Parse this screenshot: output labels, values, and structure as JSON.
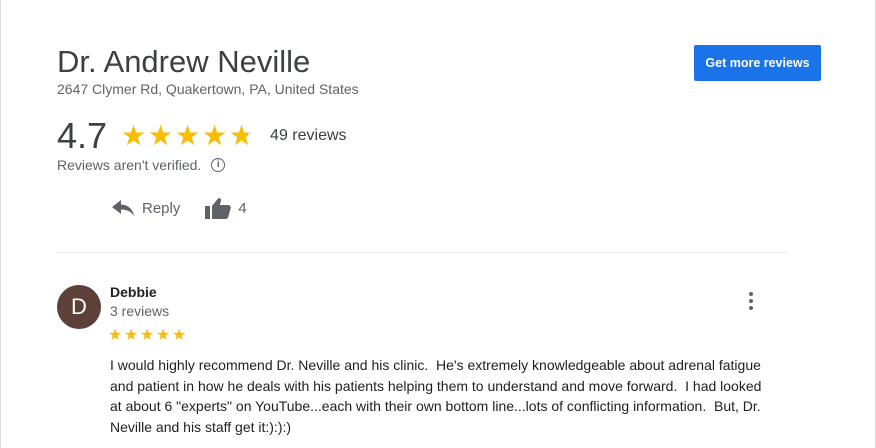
{
  "business": {
    "name": "Dr. Andrew Neville",
    "address": "2647 Clymer Rd, Quakertown, PA, United States"
  },
  "header": {
    "more_reviews_label": "Get more reviews"
  },
  "rating": {
    "value_text": "4.7",
    "value": 4.7,
    "max": 5,
    "reviews_label": "49 reviews",
    "verification_note": "Reviews aren't verified.",
    "info_icon": "info-icon"
  },
  "actions": {
    "reply_label": "Reply",
    "reply_icon": "reply-icon",
    "like_icon": "thumbs-up-icon",
    "like_count": "4"
  },
  "review": {
    "avatar_initial": "D",
    "avatar_color": "#5d4037",
    "author": "Debbie",
    "author_reviews": "3 reviews",
    "rating": 5,
    "menu_icon": "more-vert-icon",
    "text": "I would highly recommend Dr. Neville and his clinic.  He's extremely knowledgeable about adrenal fatigue and patient in how he deals with his patients helping them to understand and move forward.  I had looked at about 6 \"experts\" on YouTube...each with their own bottom line...lots of conflicting information.  But, Dr. Neville and his staff get it:):):)"
  },
  "colors": {
    "accent": "#1a73e8",
    "star": "#fbbc04",
    "star_empty": "#dadce0"
  }
}
